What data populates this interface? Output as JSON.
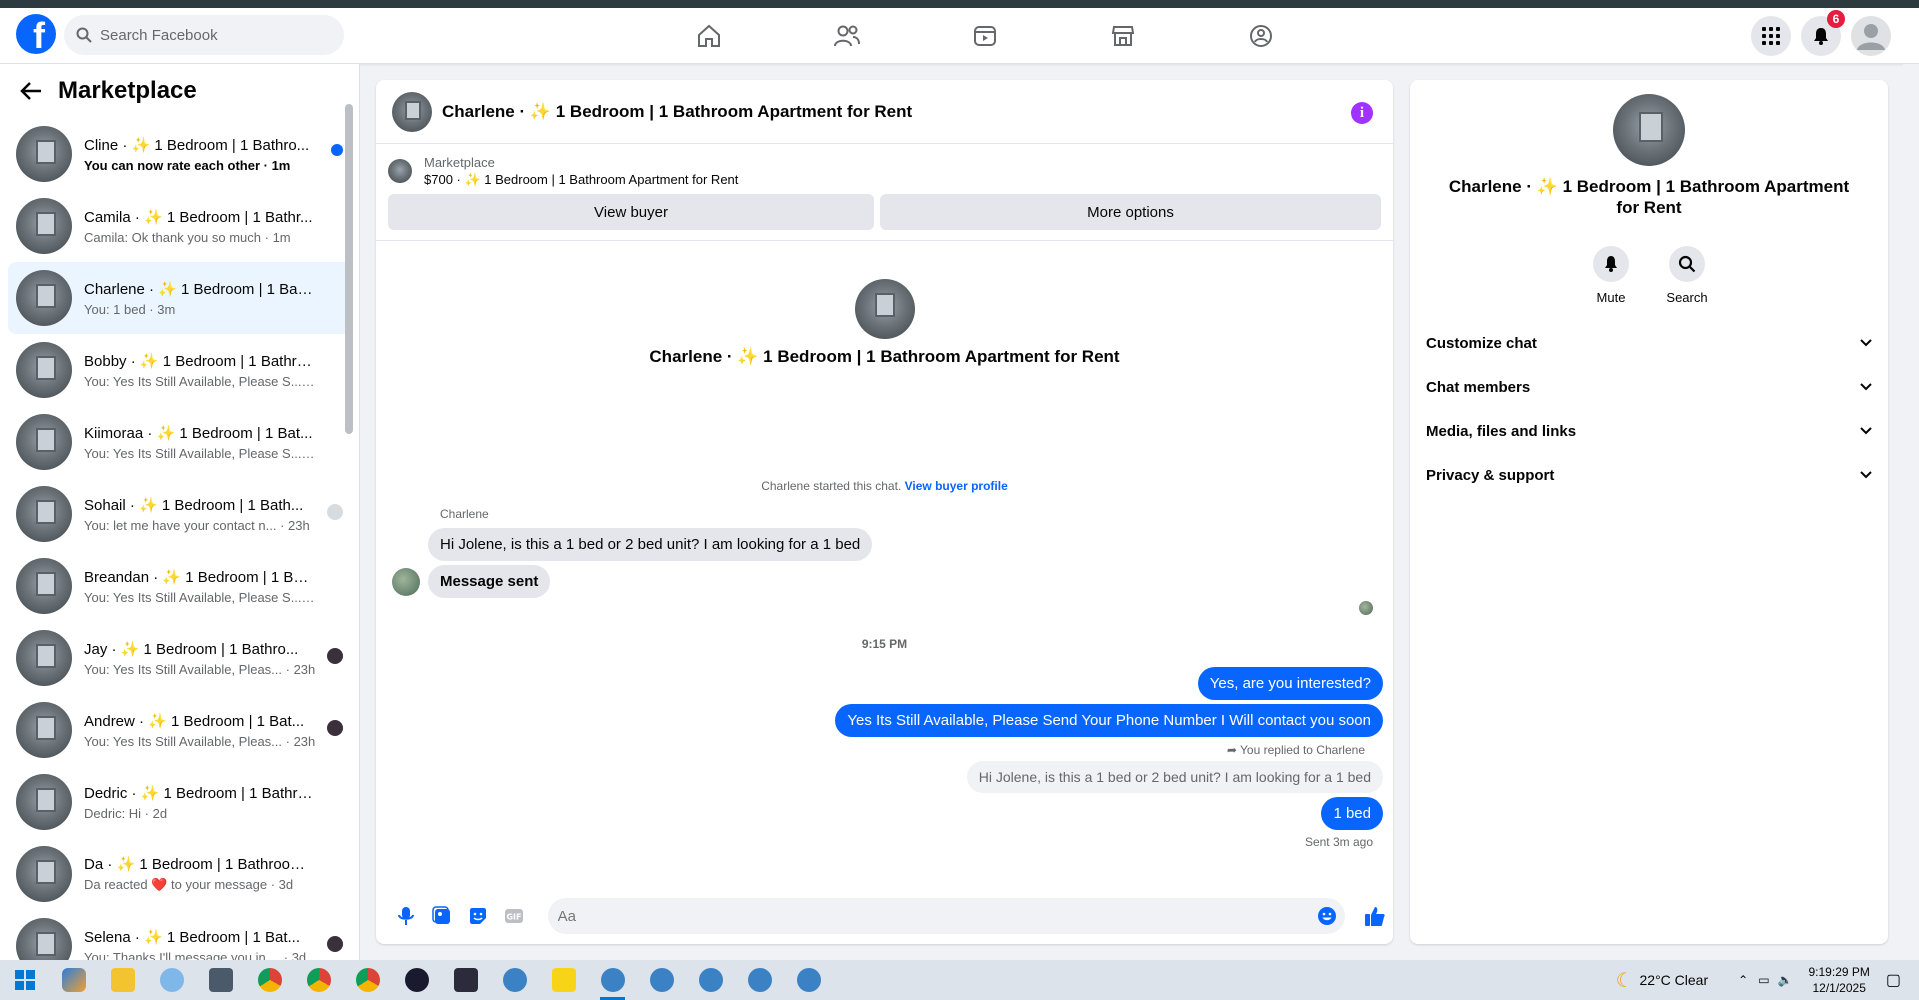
{
  "topbar": {
    "logo": "f",
    "search_placeholder": "Search Facebook",
    "nav": [
      "home-icon",
      "friends-icon",
      "video-icon",
      "marketplace-icon",
      "groups-icon"
    ],
    "notifications_count": "6"
  },
  "sidebar": {
    "title": "Marketplace",
    "conversations": [
      {
        "title": "Cline · ✨ 1 Bedroom | 1 Bathro...",
        "sub": "You can now rate each other · 1m",
        "unread": true,
        "indicator": "blue-dot"
      },
      {
        "title": "Camila · ✨ 1 Bedroom | 1 Bathr...",
        "sub": "Camila: Ok thank you so much · 1m",
        "indicator": "none"
      },
      {
        "title": "Charlene · ✨ 1 Bedroom | 1 Bath...",
        "sub": "You: 1 bed · 3m",
        "indicator": "none",
        "active": true
      },
      {
        "title": "Bobby · ✨ 1 Bedroom | 1 Bathro...",
        "sub": "You: Yes Its Still Available, Please S... · 3m",
        "indicator": "none"
      },
      {
        "title": "Kiimoraa · ✨ 1 Bedroom | 1 Bat...",
        "sub": "You: Yes Its Still Available, Please S... · 4m",
        "indicator": "none"
      },
      {
        "title": "Sohail · ✨ 1 Bedroom | 1 Bath...",
        "sub": "You: let me have your contact n... · 23h",
        "indicator": "grey-avatar"
      },
      {
        "title": "Breandan · ✨ 1 Bedroom | 1 Bat...",
        "sub": "You: Yes Its Still Available, Please S... · 23h",
        "indicator": "none"
      },
      {
        "title": "Jay · ✨ 1 Bedroom | 1 Bathro...",
        "sub": "You: Yes Its Still Available, Pleas... · 23h",
        "indicator": "avatar"
      },
      {
        "title": "Andrew · ✨ 1 Bedroom | 1 Bat...",
        "sub": "You: Yes Its Still Available, Pleas... · 23h",
        "indicator": "avatar"
      },
      {
        "title": "Dedric · ✨ 1 Bedroom | 1 Bathro...",
        "sub": "Dedric: Hi · 2d",
        "indicator": "none"
      },
      {
        "title": "Da · ✨ 1 Bedroom | 1 Bathroom ...",
        "sub": "Da reacted ❤️ to your message · 3d",
        "indicator": "none"
      },
      {
        "title": "Selena · ✨ 1 Bedroom | 1 Bat...",
        "sub": "You: Thanks I'll message you in ... · 3d",
        "indicator": "avatar"
      }
    ]
  },
  "chat": {
    "title": "Charlene · ✨ 1 Bedroom | 1 Bathroom Apartment for Rent",
    "listing_source": "Marketplace",
    "listing_price": "$700 · ✨ 1 Bedroom | 1 Bathroom Apartment for Rent",
    "view_buyer": "View buyer",
    "more_options": "More options",
    "intro_name": "Charlene · ✨ 1 Bedroom | 1 Bathroom Apartment for Rent",
    "started_text": "Charlene started this chat.",
    "started_link": "View buyer profile",
    "sender_name": "Charlene",
    "msg_in_1": "Hi Jolene, is this a 1 bed or 2 bed unit? I am looking for a 1 bed",
    "msg_in_2": "Message sent",
    "time_sep": "9:15 PM",
    "msg_out_1": "Yes, are you interested?",
    "msg_out_2": "Yes Its Still Available, Please Send Your Phone Number I Will contact you soon",
    "replied_to": "You replied to Charlene",
    "quote": "Hi Jolene, is this a 1 bed or 2 bed unit? I am looking for a 1 bed",
    "msg_out_3": "1 bed",
    "sent_ago": "Sent 3m ago",
    "composer_placeholder": "Aa"
  },
  "info_panel": {
    "name": "Charlene · ✨ 1 Bedroom | 1 Bathroom Apartment for Rent",
    "mute": "Mute",
    "search": "Search",
    "sections": [
      "Customize chat",
      "Chat members",
      "Media, files and links",
      "Privacy & support"
    ]
  },
  "taskbar": {
    "weather": "22°C Clear",
    "time": "9:19:29 PM",
    "date": "12/1/2025"
  },
  "colors": {
    "brand": "#0866ff",
    "bubble_out": "#0866ff",
    "bubble_in": "#e4e6eb",
    "info_icon": "#a033ff",
    "badge": "#e41e3f"
  }
}
